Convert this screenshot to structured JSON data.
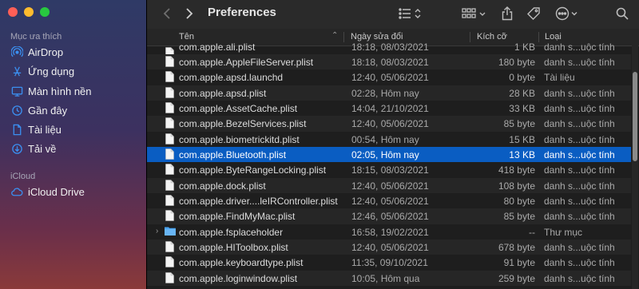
{
  "window": {
    "title": "Preferences"
  },
  "sidebar": {
    "favorites_title": "Mục ưa thích",
    "favorites": [
      {
        "label": "AirDrop",
        "icon": "airdrop-icon"
      },
      {
        "label": "Ứng dụng",
        "icon": "applications-icon"
      },
      {
        "label": "Màn hình nền",
        "icon": "desktop-icon"
      },
      {
        "label": "Gần đây",
        "icon": "recents-icon"
      },
      {
        "label": "Tài liệu",
        "icon": "document-icon"
      },
      {
        "label": "Tải về",
        "icon": "downloads-icon"
      }
    ],
    "icloud_title": "iCloud",
    "icloud": [
      {
        "label": "iCloud Drive",
        "icon": "cloud-icon"
      }
    ]
  },
  "columns": {
    "name": "Tên",
    "date": "Ngày sửa đổi",
    "size": "Kích cỡ",
    "kind": "Loại"
  },
  "rows": [
    {
      "name": "com.apple.ali.plist",
      "date": "18:18, 08/03/2021",
      "size": "1 KB",
      "kind": "danh s...uộc tính",
      "type": "file"
    },
    {
      "name": "com.apple.AppleFileServer.plist",
      "date": "18:18, 08/03/2021",
      "size": "180 byte",
      "kind": "danh s...uộc tính",
      "type": "file"
    },
    {
      "name": "com.apple.apsd.launchd",
      "date": "12:40, 05/06/2021",
      "size": "0 byte",
      "kind": "Tài liệu",
      "type": "file"
    },
    {
      "name": "com.apple.apsd.plist",
      "date": "02:28, Hôm nay",
      "size": "28 KB",
      "kind": "danh s...uộc tính",
      "type": "file"
    },
    {
      "name": "com.apple.AssetCache.plist",
      "date": "14:04, 21/10/2021",
      "size": "33 KB",
      "kind": "danh s...uộc tính",
      "type": "file"
    },
    {
      "name": "com.apple.BezelServices.plist",
      "date": "12:40, 05/06/2021",
      "size": "85 byte",
      "kind": "danh s...uộc tính",
      "type": "file"
    },
    {
      "name": "com.apple.biometrickitd.plist",
      "date": "00:54, Hôm nay",
      "size": "15 KB",
      "kind": "danh s...uộc tính",
      "type": "file"
    },
    {
      "name": "com.apple.Bluetooth.plist",
      "date": "02:05, Hôm nay",
      "size": "13 KB",
      "kind": "danh s...uộc tính",
      "type": "file",
      "selected": true
    },
    {
      "name": "com.apple.ByteRangeLocking.plist",
      "date": "18:15, 08/03/2021",
      "size": "418 byte",
      "kind": "danh s...uộc tính",
      "type": "file"
    },
    {
      "name": "com.apple.dock.plist",
      "date": "12:40, 05/06/2021",
      "size": "108 byte",
      "kind": "danh s...uộc tính",
      "type": "file"
    },
    {
      "name": "com.apple.driver....leIRController.plist",
      "date": "12:40, 05/06/2021",
      "size": "80 byte",
      "kind": "danh s...uộc tính",
      "type": "file"
    },
    {
      "name": "com.apple.FindMyMac.plist",
      "date": "12:46, 05/06/2021",
      "size": "85 byte",
      "kind": "danh s...uộc tính",
      "type": "file"
    },
    {
      "name": "com.apple.fsplaceholder",
      "date": "16:58, 19/02/2021",
      "size": "--",
      "kind": "Thư mục",
      "type": "folder"
    },
    {
      "name": "com.apple.HIToolbox.plist",
      "date": "12:40, 05/06/2021",
      "size": "678 byte",
      "kind": "danh s...uộc tính",
      "type": "file"
    },
    {
      "name": "com.apple.keyboardtype.plist",
      "date": "11:35, 09/10/2021",
      "size": "91 byte",
      "kind": "danh s...uộc tính",
      "type": "file"
    },
    {
      "name": "com.apple.loginwindow.plist",
      "date": "10:05, Hôm qua",
      "size": "259 byte",
      "kind": "danh s...uộc tính",
      "type": "file"
    }
  ],
  "colors": {
    "selection": "#0a5dc2",
    "accent": "#3b8ff0",
    "folder": "#4aa3f0"
  }
}
